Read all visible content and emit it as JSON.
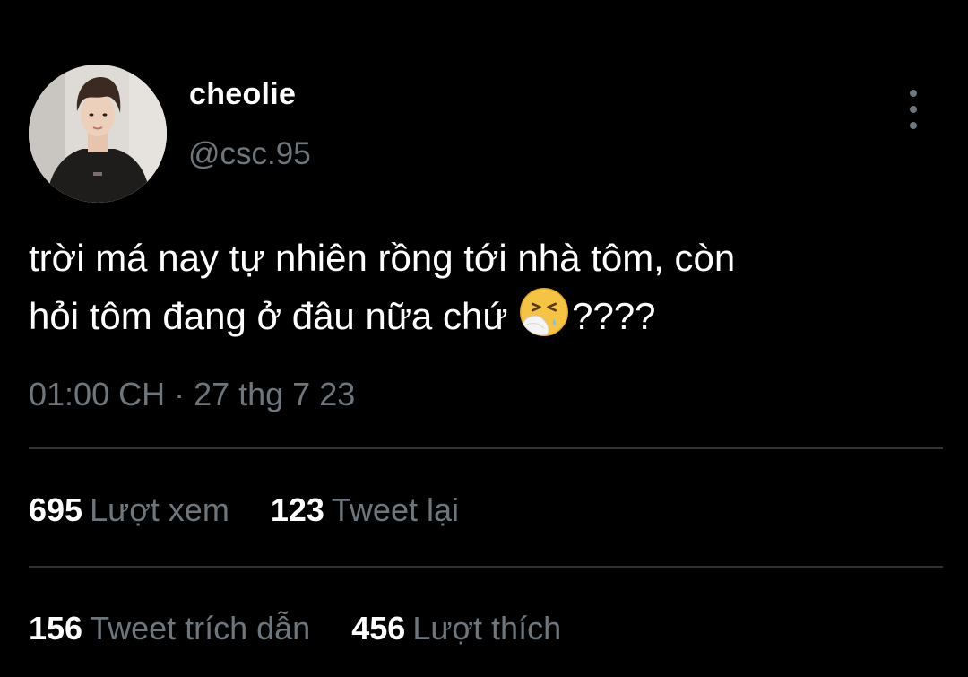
{
  "user": {
    "display_name": "cheolie",
    "handle": "@csc.95"
  },
  "tweet": {
    "text_line1": "trời má nay tự nhiên rồng tới nhà tôm, còn",
    "text_line2_before_emoji": "hỏi tôm đang ở đâu nữa chứ ",
    "emoji_name": "sneezing-face-icon",
    "text_line2_after_emoji": "????",
    "timestamp": "01:00 CH · 27 thg 7 23"
  },
  "stats": {
    "views": {
      "value": "695",
      "label": "Lượt xem"
    },
    "retweets": {
      "value": "123",
      "label": "Tweet lại"
    },
    "quotes": {
      "value": "156",
      "label": "Tweet trích dẫn"
    },
    "likes": {
      "value": "456",
      "label": "Lượt thích"
    }
  },
  "icons": {
    "more": "more-vertical-icon",
    "avatar": "avatar"
  },
  "colors": {
    "background": "#000000",
    "primary_text": "#ffffff",
    "secondary_text": "#6e767d",
    "divider": "#2f3336",
    "emoji_yellow": "#f6c443"
  }
}
